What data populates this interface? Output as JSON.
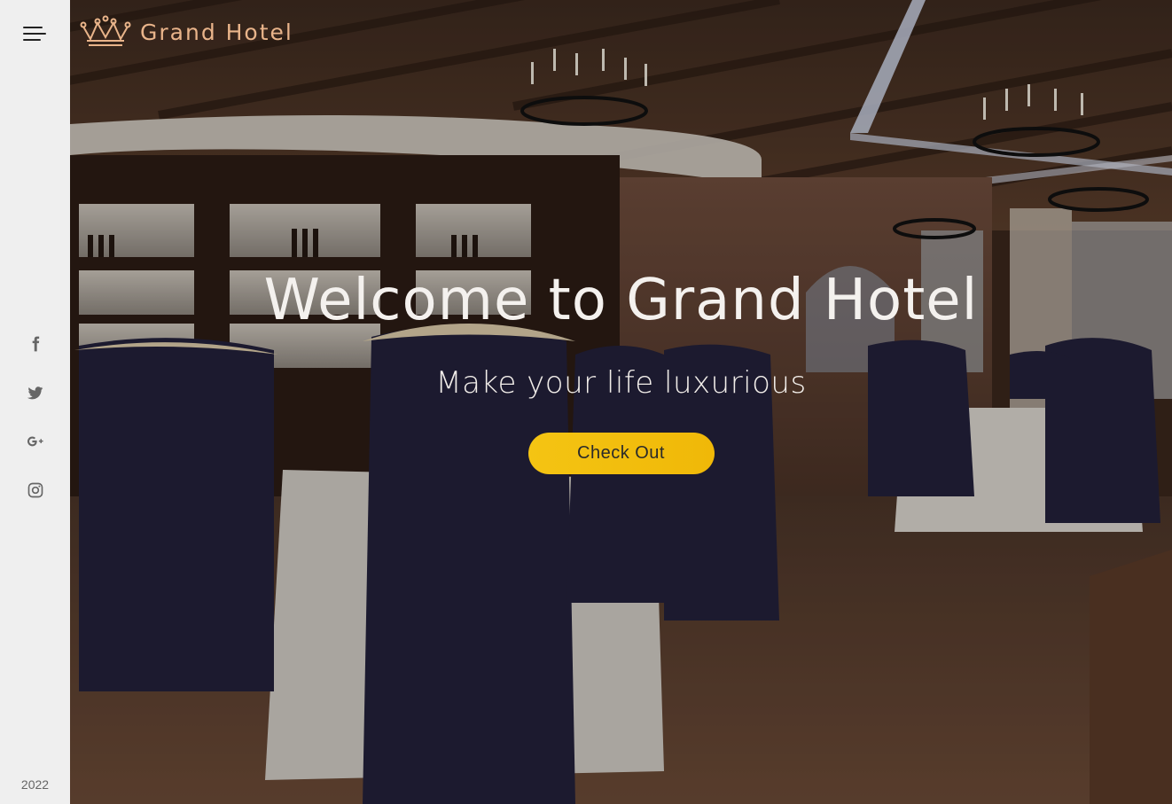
{
  "sidebar": {
    "menu_icon": "hamburger-menu-icon",
    "social": [
      {
        "name": "facebook",
        "icon": "facebook-icon"
      },
      {
        "name": "twitter",
        "icon": "twitter-icon"
      },
      {
        "name": "google-plus",
        "icon": "google-plus-icon"
      },
      {
        "name": "instagram",
        "icon": "instagram-icon"
      }
    ],
    "year": "2022"
  },
  "brand": {
    "logo_icon": "crown-icon",
    "name": "Grand Hotel",
    "color": "#e9b48a"
  },
  "hero": {
    "title": "Welcome to Grand Hotel",
    "subtitle": "Make your life luxurious",
    "cta_label": "Check Out",
    "cta_color": "#f4c413",
    "background": "restaurant-interior-image"
  },
  "colors": {
    "sidebar_bg": "#efefef",
    "icon_gray": "#666666"
  }
}
